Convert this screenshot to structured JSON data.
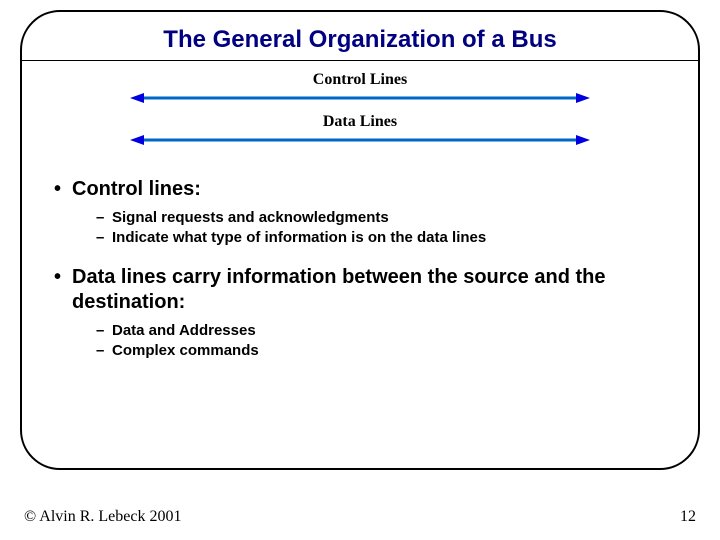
{
  "title": "The General Organization of a Bus",
  "diagram": {
    "control_label": "Control Lines",
    "data_label": "Data Lines",
    "arrow_color": "#0066cc",
    "arrowhead_color": "#0000e0"
  },
  "bullets": {
    "b1": {
      "label": "Control lines:",
      "sub": [
        "Signal requests and acknowledgments",
        "Indicate what type of information is on the data lines"
      ]
    },
    "b2": {
      "label_prefix": "Data lines",
      "label_rest": " carry information between the source and the destination:",
      "sub": [
        "Data and Addresses",
        "Complex commands"
      ]
    }
  },
  "footer": {
    "copyright": "© Alvin R. Lebeck 2001",
    "page": "12"
  }
}
